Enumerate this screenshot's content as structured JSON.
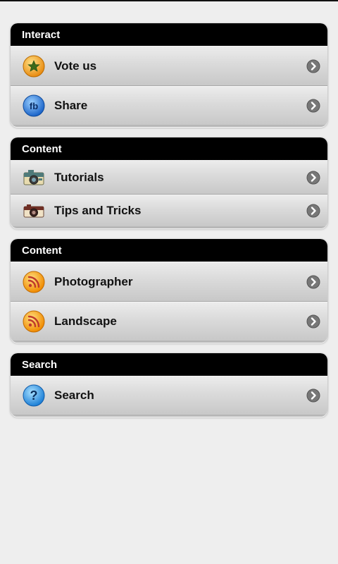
{
  "sections": [
    {
      "header": "Interact",
      "items": [
        {
          "label": "Vote us",
          "icon": "star-badge-icon"
        },
        {
          "label": "Share",
          "icon": "facebook-icon"
        }
      ]
    },
    {
      "header": "Content",
      "items": [
        {
          "label": "Tutorials",
          "icon": "camera-icon"
        },
        {
          "label": "Tips and Tricks",
          "icon": "camera-icon"
        }
      ]
    },
    {
      "header": "Content",
      "items": [
        {
          "label": "Photographer",
          "icon": "rss-icon"
        },
        {
          "label": "Landscape",
          "icon": "rss-icon"
        }
      ]
    },
    {
      "header": "Search",
      "items": [
        {
          "label": "Search",
          "icon": "help-icon"
        }
      ]
    }
  ],
  "colors": {
    "header_bg": "#000000",
    "header_text": "#ffffff",
    "row_text": "#111111",
    "chevron": "#777777"
  }
}
